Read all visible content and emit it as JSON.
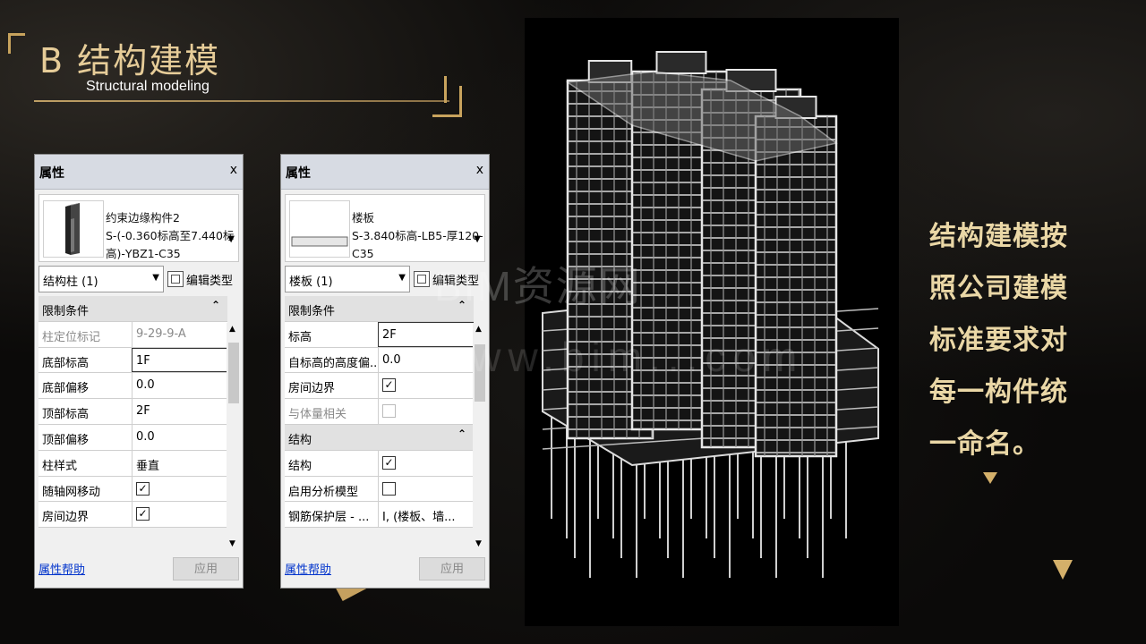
{
  "slide": {
    "title": "B  结构建模",
    "subtitle": "Structural modeling",
    "side_text_lines": [
      "结构建模按",
      "照公司建模",
      "标准要求对",
      "每一构件统",
      "一命名。"
    ],
    "watermark_line1": "BIM资源网",
    "watermark_line2": "www.bim...com",
    "accent_color": "#c8a35d"
  },
  "panel_left": {
    "title": "属性",
    "close": "x",
    "type_lines": [
      "约束边缘构件2",
      "S-(-0.360标高至7.440标",
      "高)-YBZ1-C35"
    ],
    "selector": "结构柱 (1)",
    "edit_type": "编辑类型",
    "rows": [
      {
        "kind": "group",
        "label": "限制条件",
        "collapse": "⌃"
      },
      {
        "kind": "prop",
        "label": "柱定位标记",
        "value": "9-29-9-A",
        "disabled": true
      },
      {
        "kind": "prop",
        "label": "底部标高",
        "value": "1F",
        "editing": true
      },
      {
        "kind": "prop",
        "label": "底部偏移",
        "value": "0.0"
      },
      {
        "kind": "prop",
        "label": "顶部标高",
        "value": "2F"
      },
      {
        "kind": "prop",
        "label": "顶部偏移",
        "value": "0.0"
      },
      {
        "kind": "prop",
        "label": "柱样式",
        "value": "垂直"
      },
      {
        "kind": "check",
        "label": "随轴网移动",
        "checked": true
      },
      {
        "kind": "check",
        "label": "房间边界",
        "checked": true
      }
    ],
    "help": "属性帮助",
    "apply": "应用"
  },
  "panel_right": {
    "title": "属性",
    "close": "x",
    "type_lines": [
      "楼板",
      "S-3.840标高-LB5-厚120-",
      "C35"
    ],
    "selector": "楼板 (1)",
    "edit_type": "编辑类型",
    "rows": [
      {
        "kind": "group",
        "label": "限制条件",
        "collapse": "⌃"
      },
      {
        "kind": "prop",
        "label": "标高",
        "value": "2F",
        "editing": true
      },
      {
        "kind": "prop",
        "label": "自标高的高度偏...",
        "value": "0.0"
      },
      {
        "kind": "check",
        "label": "房间边界",
        "checked": true
      },
      {
        "kind": "check",
        "label": "与体量相关",
        "checked": false,
        "disabled": true
      },
      {
        "kind": "group",
        "label": "结构",
        "collapse": "⌃"
      },
      {
        "kind": "check",
        "label": "结构",
        "checked": true
      },
      {
        "kind": "check",
        "label": "启用分析模型",
        "checked": false
      },
      {
        "kind": "prop",
        "label": "钢筋保护层 - ...",
        "value": "I, (楼板、墙..."
      }
    ],
    "help": "属性帮助",
    "apply": "应用"
  }
}
